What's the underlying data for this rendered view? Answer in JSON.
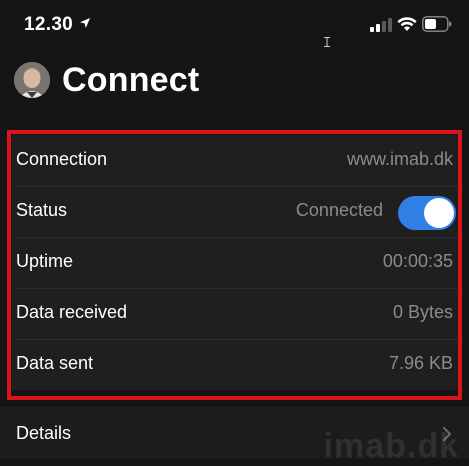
{
  "status_bar": {
    "time": "12.30",
    "icons": [
      "location-arrow-icon",
      "signal-icon",
      "wifi-icon",
      "battery-icon"
    ]
  },
  "header": {
    "title": "Connect",
    "avatar_icon": "avatar"
  },
  "info_rows": [
    {
      "label": "Connection",
      "value": "www.imab.dk"
    },
    {
      "label": "Status",
      "value": "Connected",
      "toggle_on": true
    },
    {
      "label": "Uptime",
      "value": "00:00:35"
    },
    {
      "label": "Data received",
      "value": "0 Bytes"
    },
    {
      "label": "Data sent",
      "value": "7.96 KB"
    }
  ],
  "details": {
    "label": "Details",
    "icon": "chevron-right-icon"
  },
  "watermark": "imab.dk",
  "colors": {
    "background": "#151515",
    "group_background": "#1f1f1f",
    "toggle_on": "#2f7fe5",
    "highlight": "#d8141c",
    "secondary_text": "#8b8b8f"
  }
}
